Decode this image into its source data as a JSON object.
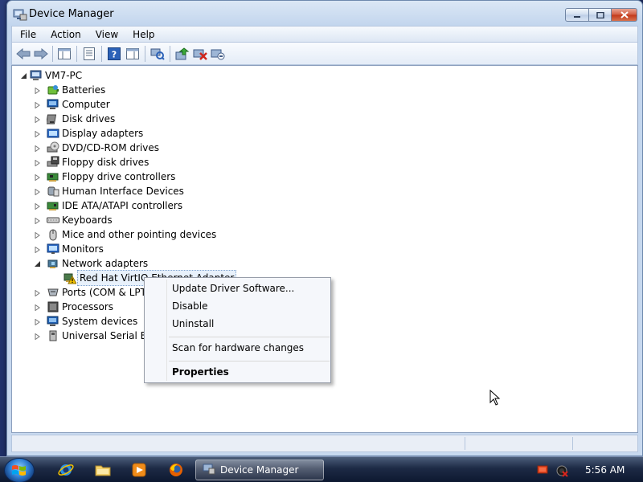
{
  "window": {
    "title": "Device Manager"
  },
  "menu": [
    "File",
    "Action",
    "View",
    "Help"
  ],
  "tree": {
    "root": "VM7-PC",
    "categories": [
      {
        "label": "Batteries",
        "icon": "battery-icon"
      },
      {
        "label": "Computer",
        "icon": "computer-icon"
      },
      {
        "label": "Disk drives",
        "icon": "disk-drive-icon"
      },
      {
        "label": "Display adapters",
        "icon": "display-adapter-icon"
      },
      {
        "label": "DVD/CD-ROM drives",
        "icon": "dvd-drive-icon"
      },
      {
        "label": "Floppy disk drives",
        "icon": "floppy-disk-icon"
      },
      {
        "label": "Floppy drive controllers",
        "icon": "floppy-controller-icon"
      },
      {
        "label": "Human Interface Devices",
        "icon": "hid-icon"
      },
      {
        "label": "IDE ATA/ATAPI controllers",
        "icon": "ide-controller-icon"
      },
      {
        "label": "Keyboards",
        "icon": "keyboard-icon"
      },
      {
        "label": "Mice and other pointing devices",
        "icon": "mouse-icon"
      },
      {
        "label": "Monitors",
        "icon": "monitor-icon"
      },
      {
        "label": "Network adapters",
        "icon": "network-adapter-icon"
      },
      {
        "label": "Ports (COM & LPT)",
        "icon": "port-icon"
      },
      {
        "label": "Processors",
        "icon": "processor-icon"
      },
      {
        "label": "System devices",
        "icon": "system-device-icon"
      },
      {
        "label": "Universal Serial Bus",
        "icon": "usb-icon"
      }
    ],
    "network_child": "Red Hat VirtIO Ethernet Adapter"
  },
  "context_menu": {
    "items": [
      {
        "label": "Update Driver Software...",
        "bold": false
      },
      {
        "label": "Disable",
        "bold": false
      },
      {
        "label": "Uninstall",
        "bold": false
      },
      {
        "label": "Scan for hardware changes",
        "bold": false
      },
      {
        "label": "Properties",
        "bold": true
      }
    ]
  },
  "taskbar": {
    "active_task": "Device Manager",
    "clock": "5:56 AM"
  },
  "colors": {
    "accent": "#2f7ed3",
    "warning": "#f2c200"
  }
}
